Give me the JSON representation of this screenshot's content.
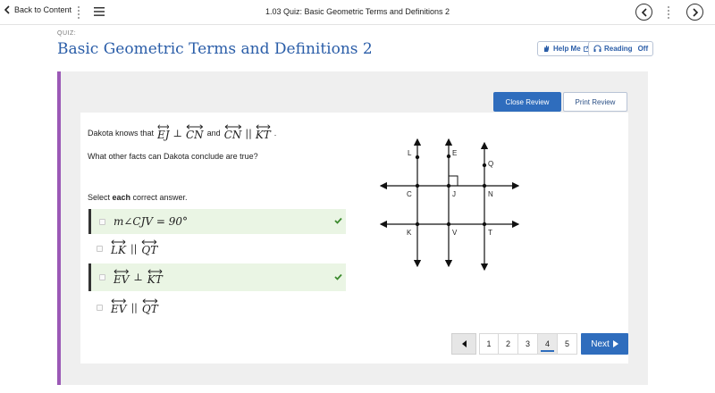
{
  "topbar": {
    "back_label": "Back to Content",
    "title": "1.03 Quiz: Basic Geometric Terms and Definitions 2"
  },
  "header": {
    "quiz_label": "QUIZ:",
    "heading": "Basic Geometric Terms and Definitions 2",
    "help_label": "Help Me",
    "reading_label": "Reading",
    "reading_state": "Off"
  },
  "review": {
    "close_label": "Close Review",
    "print_label": "Print Review"
  },
  "question": {
    "prefix": "Dakota knows that",
    "line1_a": "EJ",
    "perp": "⊥",
    "line1_b": "CN",
    "and": "and",
    "line2_a": "CN",
    "parallel": "||",
    "line2_b": "KT",
    "period": ".",
    "prompt": "What other facts can Dakota conclude are true?",
    "select_pre": "Select ",
    "select_bold": "each",
    "select_post": " correct answer."
  },
  "options": [
    {
      "math": "m∠CJV = 90°",
      "correct": true
    },
    {
      "a": "LK",
      "op": "||",
      "b": "QT",
      "correct": false
    },
    {
      "a": "EV",
      "op": "⊥",
      "b": "KT",
      "correct": true
    },
    {
      "a": "EV",
      "op": "||",
      "b": "QT",
      "correct": false
    }
  ],
  "diagram_labels": {
    "L": "L",
    "E": "E",
    "Q": "Q",
    "C": "C",
    "J": "J",
    "N": "N",
    "K": "K",
    "V": "V",
    "T": "T"
  },
  "pager": {
    "pages": [
      "1",
      "2",
      "3",
      "4",
      "5"
    ],
    "current": "4",
    "next_label": "Next"
  },
  "colors": {
    "accent": "#2f6dbd",
    "heading": "#2a5da8",
    "correct_bg": "#eaf5e4",
    "check": "#3c8a2e",
    "panel_border": "#9b59b6"
  }
}
